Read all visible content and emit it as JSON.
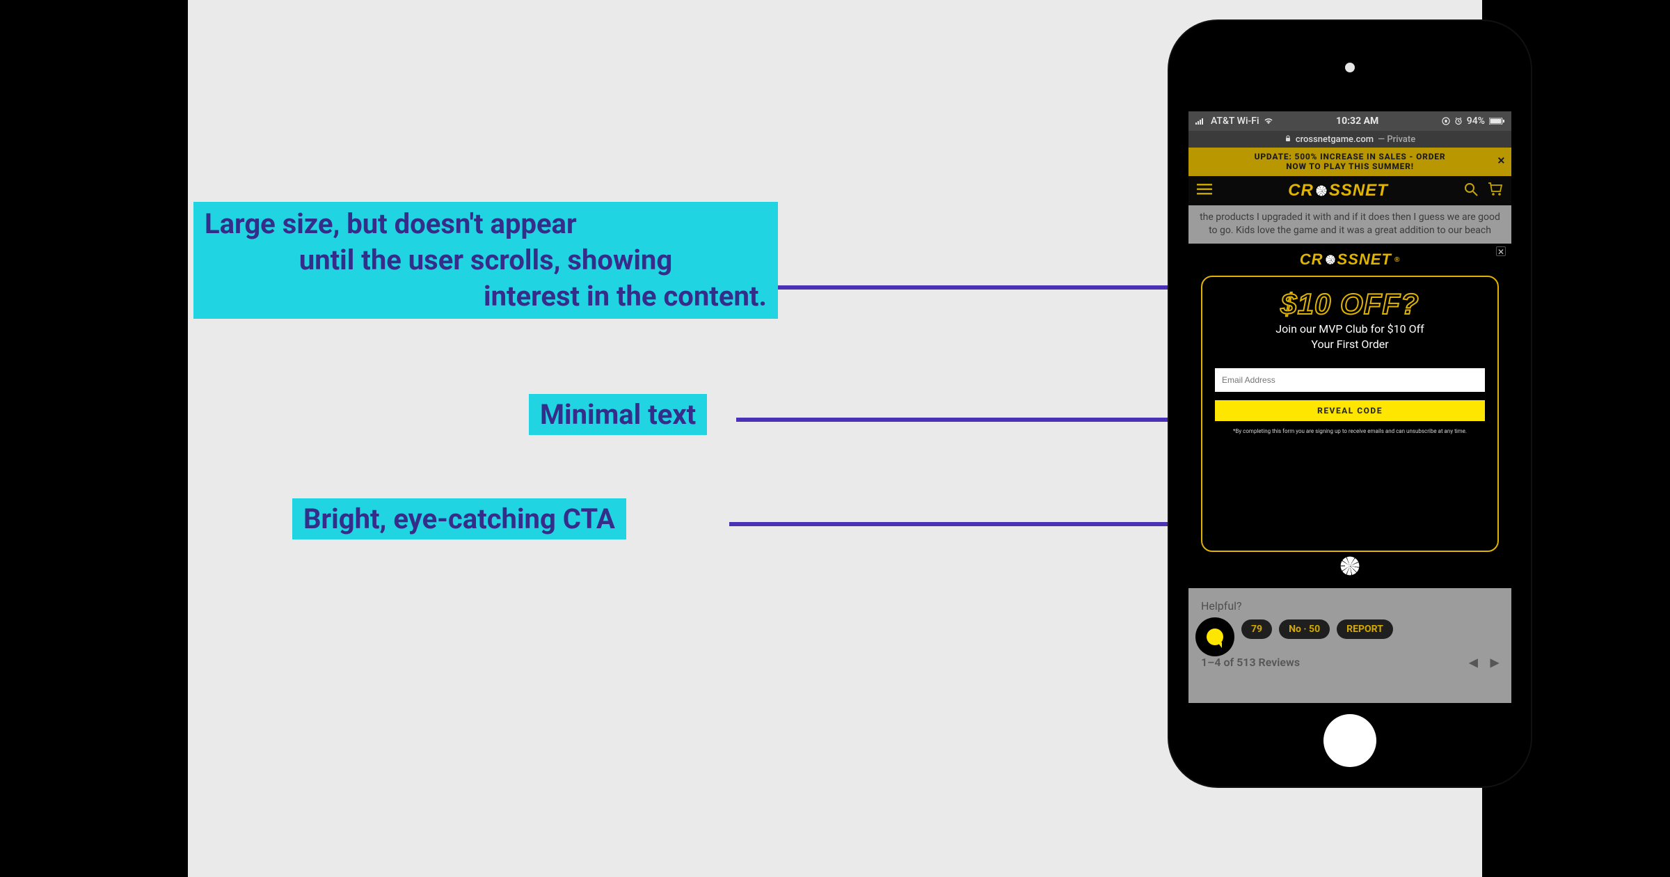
{
  "annotations": {
    "a1_l1": "Large size, but doesn't appear",
    "a1_l2": "until the user scrolls, showing",
    "a1_l3": "interest in the content.",
    "a2": "Minimal text",
    "a3": "Bright, eye-catching CTA"
  },
  "statusbar": {
    "carrier": "AT&T Wi-Fi",
    "time": "10:32 AM",
    "battery": "94%"
  },
  "urlbar": {
    "host": "crossnetgame.com",
    "mode": "— Private"
  },
  "banner": {
    "line1": "UPDATE: 500% INCREASE IN SALES - ORDER",
    "line2": "NOW TO PLAY THIS SUMMER!"
  },
  "brand": {
    "pre": "CR",
    "post": "SSNET"
  },
  "review": {
    "text": "the products I upgraded it with and if it does then I guess we are good to go. Kids love the game and it was a great addition to our beach"
  },
  "modal": {
    "headline": "$10 OFF?",
    "sub_l1": "Join our MVP Club for $10 Off",
    "sub_l2": "Your First Order",
    "email_placeholder": "Email Address",
    "cta": "REVEAL CODE",
    "disclaimer": "*By completing this form you are signing up to receive emails and can unsubscribe at any time."
  },
  "below": {
    "helpful": "Helpful?",
    "yes": "79",
    "no": "No · 50",
    "report": "REPORT",
    "pager": "1–4 of 513 Reviews"
  }
}
